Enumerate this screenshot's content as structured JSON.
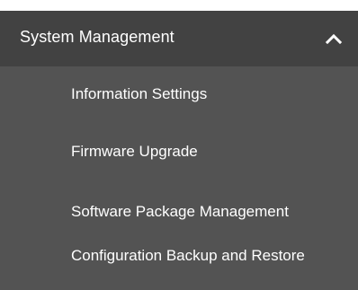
{
  "section": {
    "title": "System Management",
    "expanded_icon": "chevron-up-icon"
  },
  "menu": {
    "items": [
      {
        "label": "Information Settings"
      },
      {
        "label": "Firmware Upgrade"
      },
      {
        "label": "Software Package Management"
      },
      {
        "label": "Configuration Backup and Restore"
      }
    ]
  },
  "colors": {
    "header_bg": "#424242",
    "menu_bg": "#535353",
    "text": "#ffffff"
  }
}
